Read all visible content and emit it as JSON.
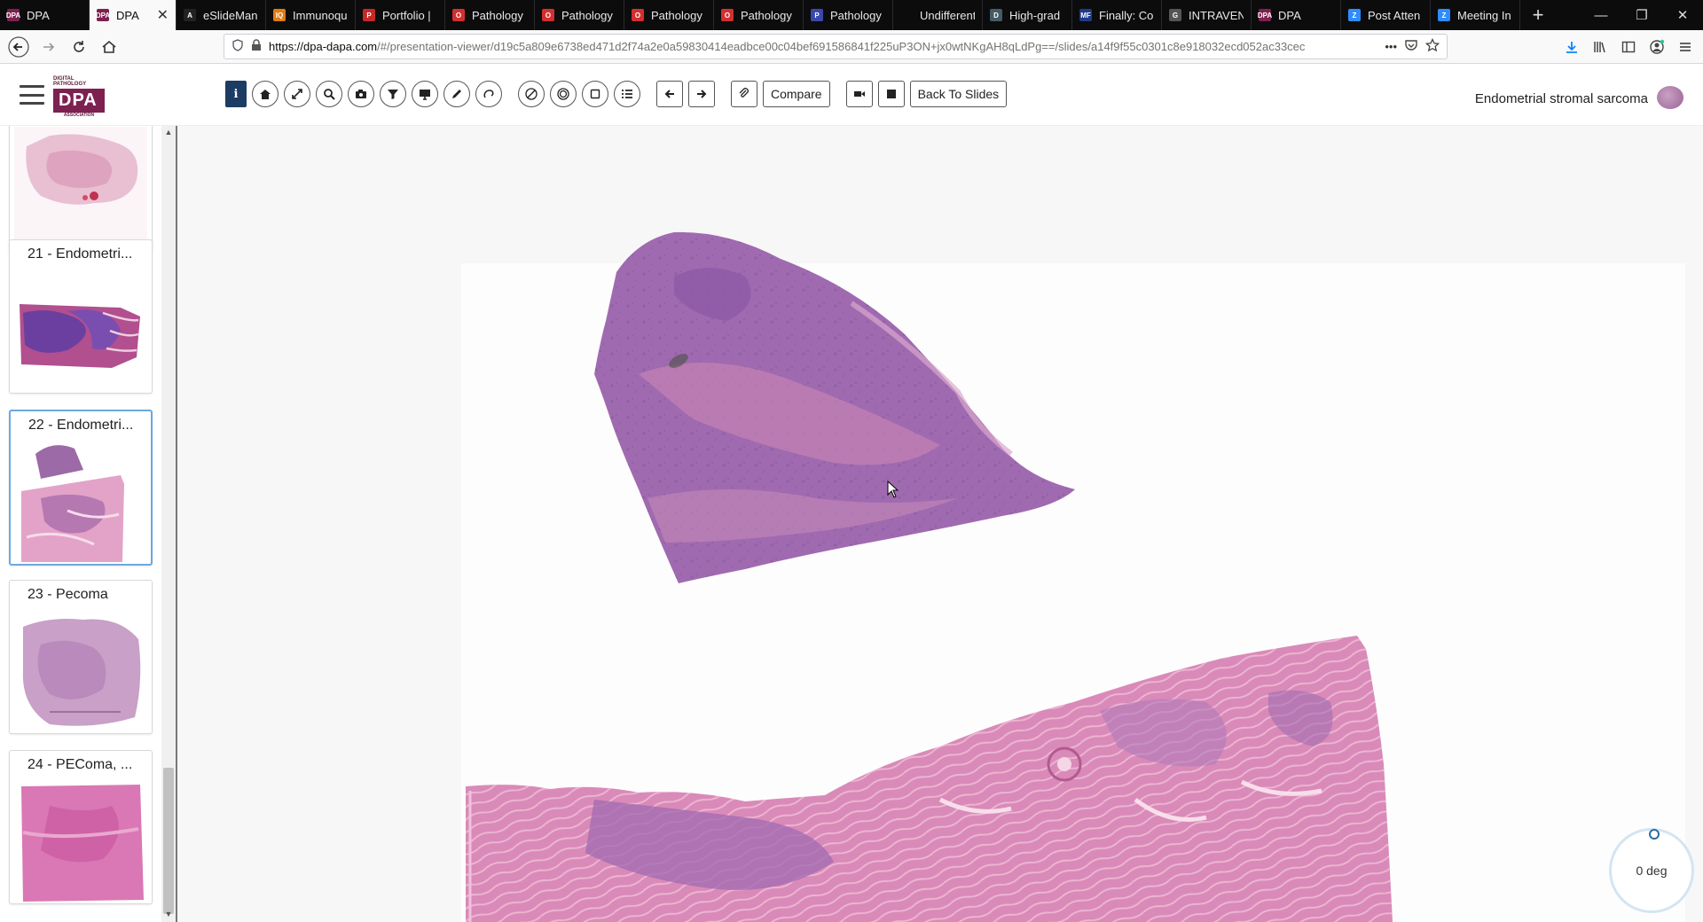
{
  "browser": {
    "tabs": [
      {
        "label": "DPA",
        "fav_color": "#7d2150",
        "fav": "DPA"
      },
      {
        "label": "DPA",
        "fav_color": "#7d2150",
        "fav": "DPA",
        "active": true
      },
      {
        "label": "eSlideMan",
        "fav_color": "#222",
        "fav": "A"
      },
      {
        "label": "Immunoqu",
        "fav_color": "#e07b12",
        "fav": "IQ"
      },
      {
        "label": "Portfolio |",
        "fav_color": "#c62828",
        "fav": "P"
      },
      {
        "label": "Pathology",
        "fav_color": "#d32f2f",
        "fav": "O"
      },
      {
        "label": "Pathology",
        "fav_color": "#d32f2f",
        "fav": "O"
      },
      {
        "label": "Pathology",
        "fav_color": "#d32f2f",
        "fav": "O"
      },
      {
        "label": "Pathology",
        "fav_color": "#d32f2f",
        "fav": "O"
      },
      {
        "label": "Pathology",
        "fav_color": "#3949ab",
        "fav": "P"
      },
      {
        "label": "Undifferentiat",
        "fav_color": "#0c0c0d",
        "fav": ""
      },
      {
        "label": "High-grad",
        "fav_color": "#455a64",
        "fav": "D"
      },
      {
        "label": "Finally: Co",
        "fav_color": "#1e3a8a",
        "fav": "MF"
      },
      {
        "label": "INTRAVEN",
        "fav_color": "#555",
        "fav": "G"
      },
      {
        "label": "DPA",
        "fav_color": "#7d2150",
        "fav": "DPA"
      },
      {
        "label": "Post Atten",
        "fav_color": "#2d8cff",
        "fav": "Z"
      },
      {
        "label": "Meeting In",
        "fav_color": "#2d8cff",
        "fav": "Z"
      }
    ],
    "close_glyph": "✕",
    "new_tab_glyph": "+",
    "url_host": "https://dpa-dapa.com",
    "url_rest": "/#/presentation-viewer/d19c5a809e6738ed471d2f74a2e0a59830414eadbce00c04bef691586841f225uP3ON+jx0wtNKgAH8qLdPg==/slides/a14f9f55c0301c8e918032ecd052ac33cec",
    "url_more": "•••"
  },
  "app": {
    "logo_top": "DIGITAL PATHOLOGY",
    "logo_mark": "DPA",
    "logo_bottom": "ASSOCIATION",
    "toolbar": {
      "compare_label": "Compare",
      "back_label": "Back To Slides",
      "info_glyph": "i"
    },
    "case_title": "Endometrial stromal sarcoma"
  },
  "sidebar": {
    "slides": [
      {
        "title": "",
        "selected": false
      },
      {
        "title": "21 - Endometri...",
        "selected": false
      },
      {
        "title": "22 - Endometri...",
        "selected": true
      },
      {
        "title": "23 - Pecoma",
        "selected": false
      },
      {
        "title": "24 - PEComa, ...",
        "selected": false
      }
    ]
  },
  "viewer": {
    "rotation_label": "0 deg"
  },
  "colors": {
    "brand": "#7d2150",
    "info_button": "#1d3c63",
    "selection": "#6aa9e0",
    "tissue_dark": "#8a5c9e",
    "tissue_pink": "#d98ab8"
  }
}
